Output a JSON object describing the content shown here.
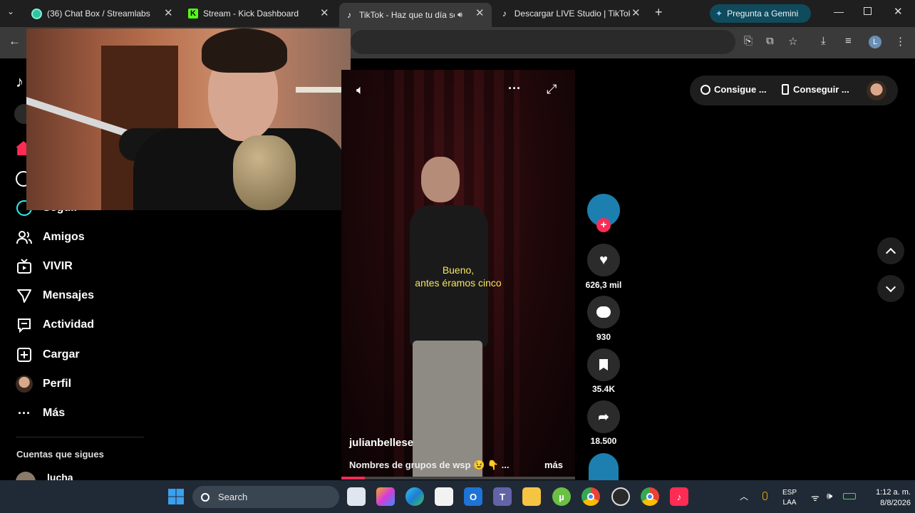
{
  "browser": {
    "tabs": [
      {
        "title": "(36) Chat Box / Streamlabs",
        "active": false
      },
      {
        "title": "Stream - Kick Dashboard",
        "active": false
      },
      {
        "title": "TikTok - Haz que tu día sea",
        "active": true
      },
      {
        "title": "Descargar LIVE Studio | TikTok",
        "active": false
      }
    ],
    "gemini_label": "Pregunta a Gemini",
    "profile_initial": "L"
  },
  "sidebar": {
    "items": [
      {
        "label": "Seguir",
        "icon": "following-icon"
      },
      {
        "label": "Amigos",
        "icon": "friends-icon"
      },
      {
        "label": "VIVIR",
        "icon": "live-tv-icon"
      },
      {
        "label": "Mensajes",
        "icon": "send-icon"
      },
      {
        "label": "Actividad",
        "icon": "activity-icon"
      },
      {
        "label": "Cargar",
        "icon": "upload-icon"
      },
      {
        "label": "Perfil",
        "icon": "avatar-icon"
      },
      {
        "label": "Más",
        "icon": "more-icon"
      }
    ],
    "following_heading": "Cuentas que sigues",
    "following_first": "lucha"
  },
  "topbar": {
    "coins_label": "Consigue ...",
    "app_label": "Conseguir ..."
  },
  "video": {
    "subtitle_line1": "Bueno,",
    "subtitle_line2": "antes éramos cinco",
    "author": "julianbellese",
    "caption": "Nombres de grupos de wsp 😉 👇 ...",
    "more_label": "más",
    "progress": 0.1
  },
  "actions": {
    "likes": "626,3 mil",
    "comments": "930",
    "saves": "35.4K",
    "shares": "18.500"
  },
  "taskbar": {
    "search_label": "Search",
    "lang_line1": "ESP",
    "lang_line2": "LAA",
    "time": "1:12 a. m.",
    "date": "8/8/2026"
  },
  "colors": {
    "tiktok_red": "#fe2c55",
    "gemini_pill": "#0f4b5c",
    "kick_green": "#53fc18",
    "subtitle_yellow": "#f5e663"
  }
}
